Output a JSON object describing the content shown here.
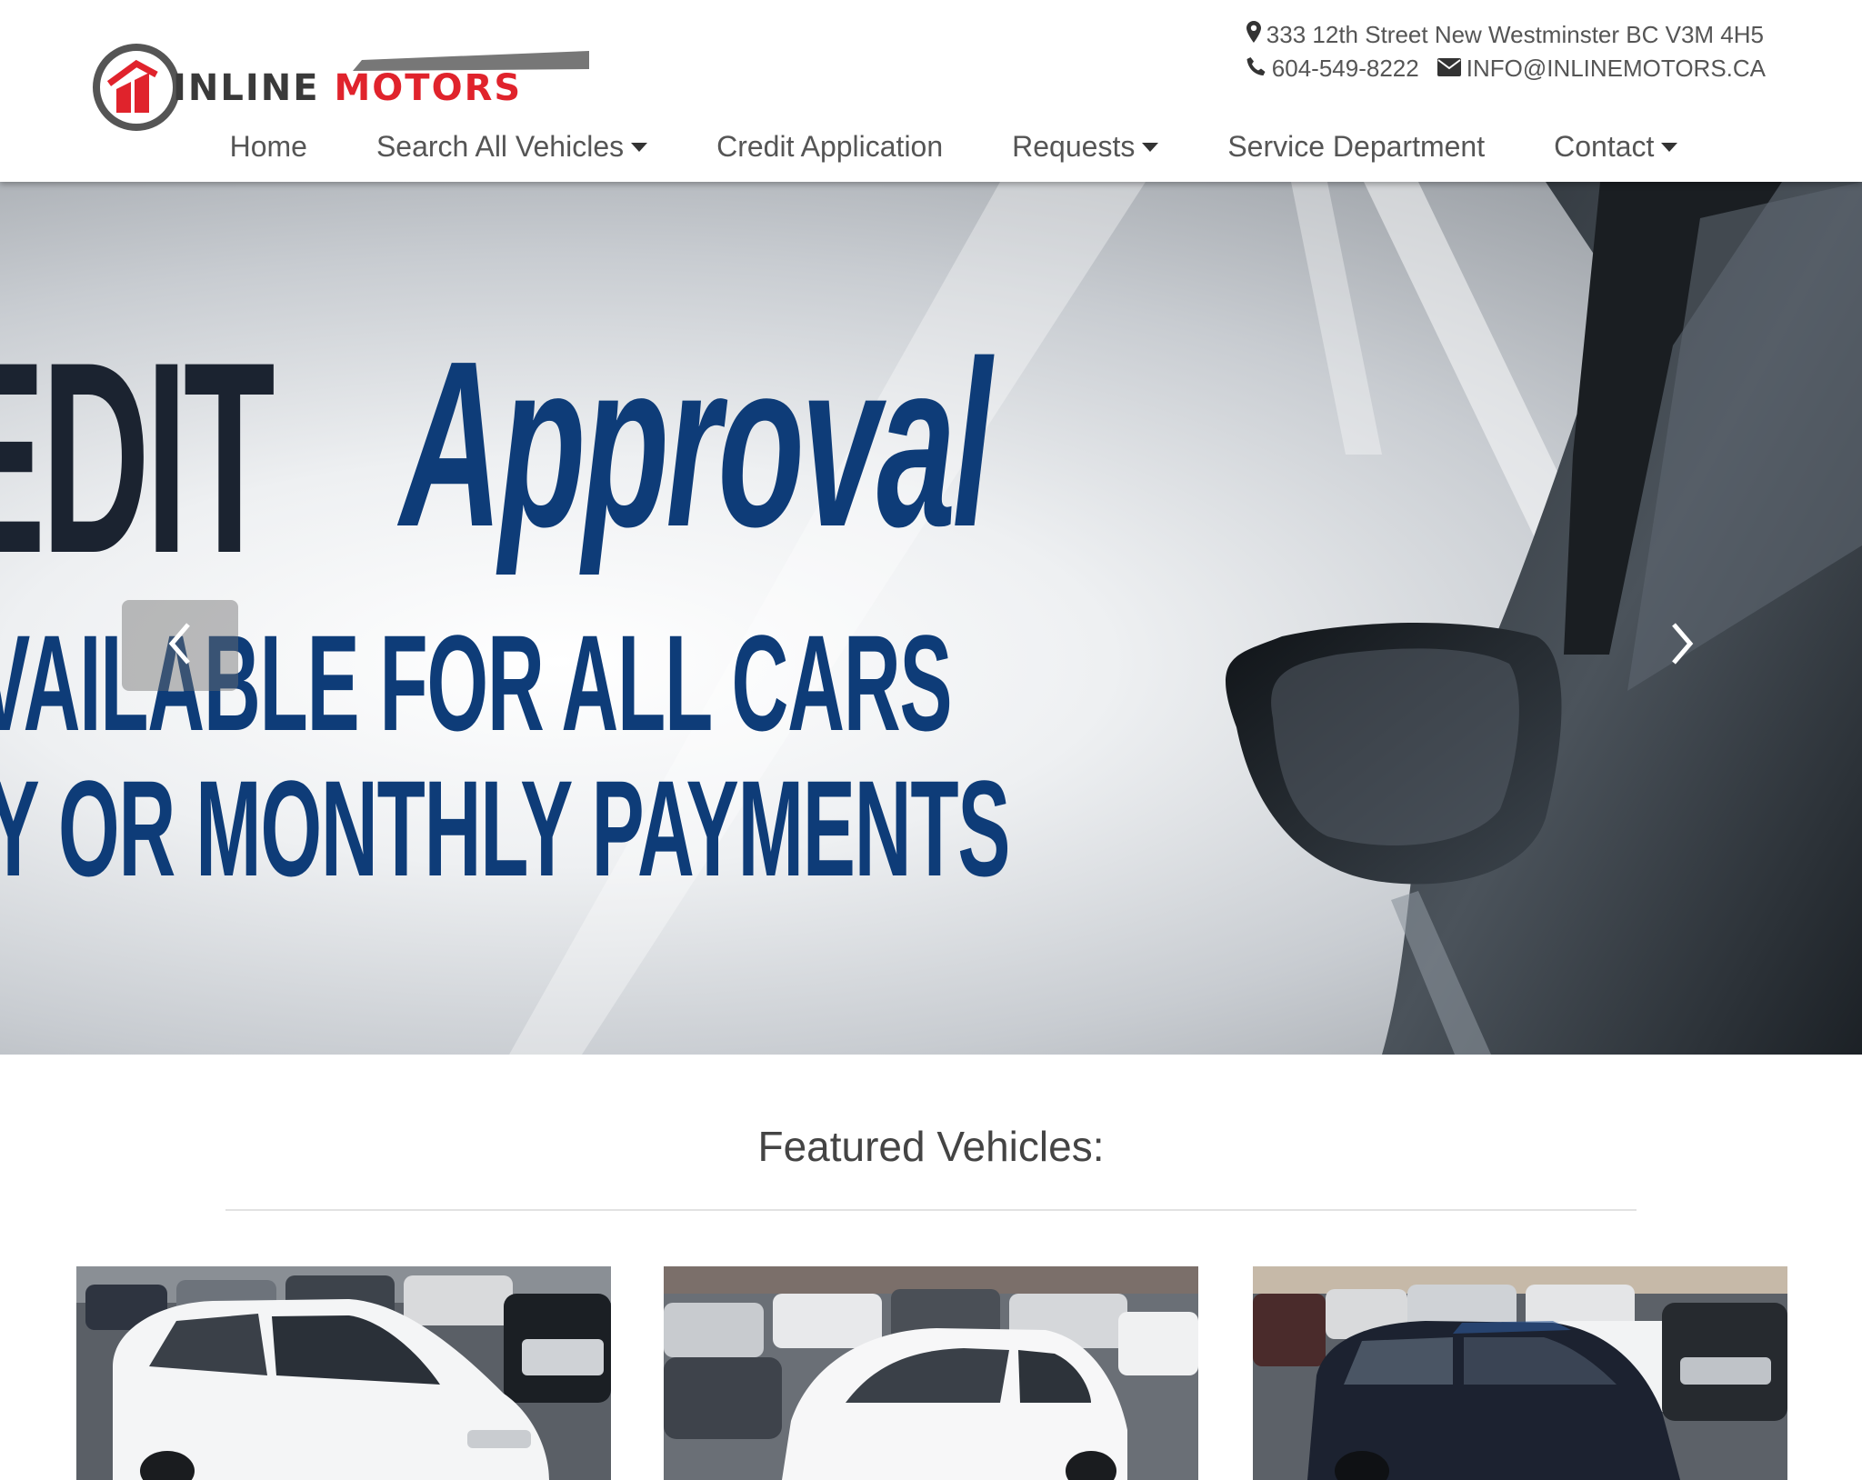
{
  "brand": {
    "logo_word1": "INLINE",
    "logo_word2": "MOTORS",
    "colors": {
      "red": "#e0232c",
      "dark": "#3a3a3a"
    }
  },
  "contact": {
    "address": "333 12th Street New Westminster BC V3M 4H5",
    "phone": "604-549-8222",
    "email": "INFO@INLINEMOTORS.CA",
    "icons": {
      "address": "map-marker-icon",
      "phone": "phone-icon",
      "email": "envelope-icon"
    }
  },
  "nav": {
    "items": [
      {
        "label": "Home",
        "dropdown": false
      },
      {
        "label": "Search All Vehicles",
        "dropdown": true
      },
      {
        "label": "Credit Application",
        "dropdown": false
      },
      {
        "label": "Requests",
        "dropdown": true
      },
      {
        "label": "Service Department",
        "dropdown": false
      },
      {
        "label": "Contact",
        "dropdown": true
      }
    ]
  },
  "hero": {
    "line1_a": "EDIT",
    "line1_b": "Approval",
    "line2": "AVAILABLE FOR ALL CARS",
    "line3": "KLY OR MONTHLY PAYMENTS",
    "controls": {
      "prev": "chevron-left-icon",
      "next": "chevron-right-icon"
    }
  },
  "featured": {
    "title": "Featured Vehicles:",
    "cards": [
      {
        "subject": "white-minivan-photo"
      },
      {
        "subject": "white-hatchback-photo"
      },
      {
        "subject": "dark-suv-photo"
      }
    ]
  }
}
